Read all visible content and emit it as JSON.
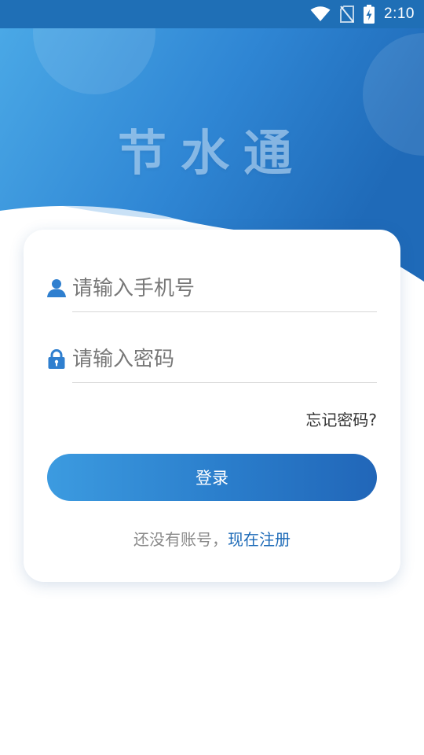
{
  "status_bar": {
    "time": "2:10",
    "icons": [
      "wifi-icon",
      "no-sim-icon",
      "battery-charging-icon"
    ]
  },
  "header": {
    "app_name": "节水通",
    "colors": {
      "gradient_start": "#4aa8e6",
      "gradient_end": "#1f6ab8"
    }
  },
  "login_form": {
    "phone_input": {
      "placeholder": "请输入手机号",
      "value": "",
      "icon": "user-icon"
    },
    "password_input": {
      "placeholder": "请输入密码",
      "value": "",
      "icon": "lock-icon"
    },
    "forgot_password": "忘记密码?",
    "login_button": "登录",
    "register_prompt": "还没有账号，",
    "register_link": "现在注册"
  },
  "colors": {
    "accent": "#2a7dcb",
    "link": "#1e6bb8",
    "icon": "#2f7fcf"
  }
}
